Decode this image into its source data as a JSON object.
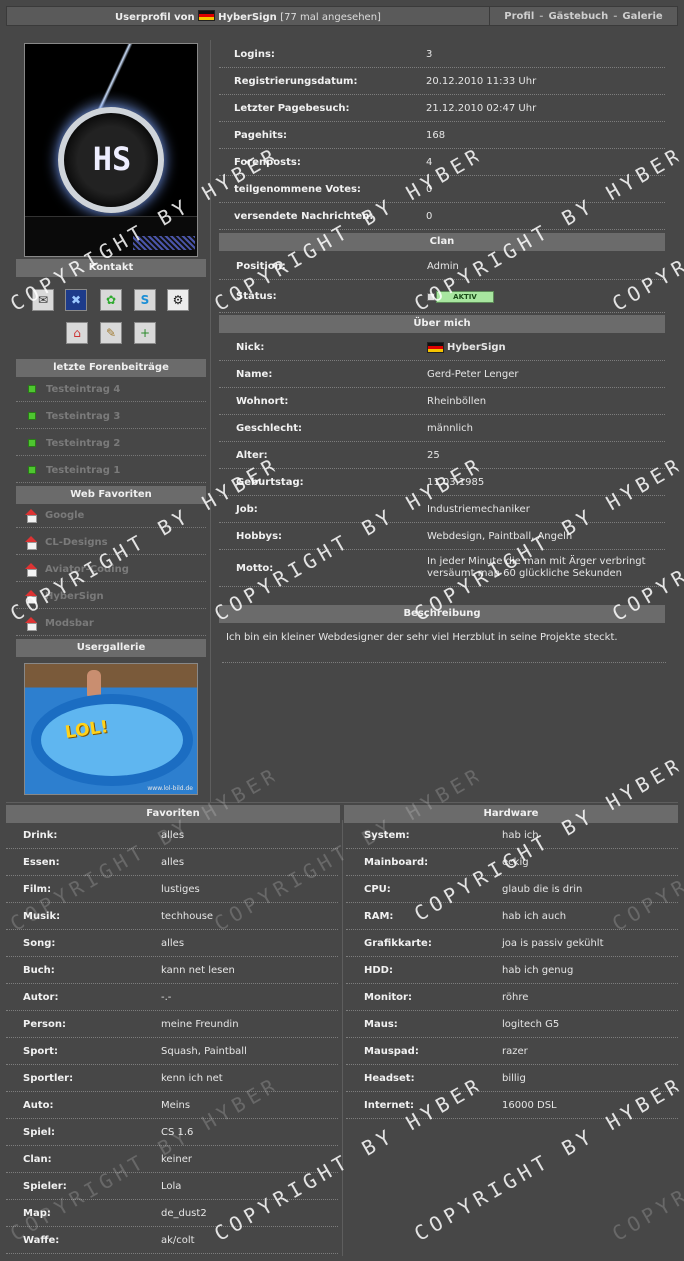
{
  "header": {
    "title_prefix": "Userprofil von",
    "username": "HyberSign",
    "views": "[77 mal angesehen]",
    "nav": [
      "Profil",
      "Gästebuch",
      "Galerie"
    ]
  },
  "stats": [
    {
      "label": "Logins:",
      "value": "3"
    },
    {
      "label": "Registrierungsdatum:",
      "value": "20.12.2010 11:33 Uhr"
    },
    {
      "label": "Letzter Pagebesuch:",
      "value": "21.12.2010 02:47 Uhr"
    },
    {
      "label": "Pagehits:",
      "value": "168"
    },
    {
      "label": "Forenposts:",
      "value": "4"
    },
    {
      "label": "teilgenommene Votes:",
      "value": "0"
    },
    {
      "label": "versendete Nachrichten:",
      "value": "0"
    }
  ],
  "clan": {
    "heading": "Clan",
    "position_label": "Position:",
    "position_value": "Admin",
    "status_label": "Status:",
    "status_badge": "AKTIV"
  },
  "about": {
    "heading": "Über mich",
    "rows": [
      {
        "label": "Nick:",
        "value": "HyberSign"
      },
      {
        "label": "Name:",
        "value": "Gerd-Peter Lenger"
      },
      {
        "label": "Wohnort:",
        "value": "Rheinböllen"
      },
      {
        "label": "Geschlecht:",
        "value": "männlich"
      },
      {
        "label": "Alter:",
        "value": "25"
      },
      {
        "label": "Geburtstag:",
        "value": "11.03.1985"
      },
      {
        "label": "Job:",
        "value": "Industriemechaniker"
      },
      {
        "label": "Hobbys:",
        "value": "Webdesign, Paintball, Angeln"
      },
      {
        "label": "Motto:",
        "value": "In jeder Minute die man mit Ärger verbringt versäumt man 60 glückliche Sekunden"
      }
    ]
  },
  "description": {
    "heading": "Beschreibung",
    "text": "Ich bin ein kleiner Webdesigner der sehr viel Herzblut in seine Projekte steckt."
  },
  "sidebar": {
    "contact_heading": "Kontakt",
    "contact_icons": [
      "mail-icon",
      "xfire-icon",
      "icq-icon",
      "skype-icon",
      "steam-icon",
      "homepage-icon",
      "guestbook-icon",
      "add-buddy-icon"
    ],
    "posts_heading": "letzte Forenbeiträge",
    "posts": [
      "Testeintrag 4",
      "Testeintrag 3",
      "Testeintrag 2",
      "Testeintrag 1"
    ],
    "favs_heading": "Web Favoriten",
    "favs": [
      "Google",
      "CL-Designs",
      "Aviator-Coding",
      "HyberSign",
      "Modsbar"
    ],
    "gallery_heading": "Usergallerie",
    "gallery_caption": "LOL!",
    "gallery_watermark": "www.lol-bild.de"
  },
  "favoriten": {
    "heading": "Favoriten",
    "rows": [
      {
        "label": "Drink:",
        "value": "alles"
      },
      {
        "label": "Essen:",
        "value": "alles"
      },
      {
        "label": "Film:",
        "value": "lustiges"
      },
      {
        "label": "Musik:",
        "value": "techhouse"
      },
      {
        "label": "Song:",
        "value": "alles"
      },
      {
        "label": "Buch:",
        "value": "kann net lesen"
      },
      {
        "label": "Autor:",
        "value": "-.-"
      },
      {
        "label": "Person:",
        "value": "meine Freundin"
      },
      {
        "label": "Sport:",
        "value": "Squash, Paintball"
      },
      {
        "label": "Sportler:",
        "value": "kenn ich net"
      },
      {
        "label": "Auto:",
        "value": "Meins"
      },
      {
        "label": "Spiel:",
        "value": "CS 1.6"
      },
      {
        "label": "Clan:",
        "value": "keiner"
      },
      {
        "label": "Spieler:",
        "value": "Lola"
      },
      {
        "label": "Map:",
        "value": "de_dust2"
      },
      {
        "label": "Waffe:",
        "value": "ak/colt"
      }
    ]
  },
  "hardware": {
    "heading": "Hardware",
    "rows": [
      {
        "label": "System:",
        "value": "hab ich"
      },
      {
        "label": "Mainboard:",
        "value": "eckig"
      },
      {
        "label": "CPU:",
        "value": "glaub die is drin"
      },
      {
        "label": "RAM:",
        "value": "hab ich auch"
      },
      {
        "label": "Grafikkarte:",
        "value": "joa is passiv gekühlt"
      },
      {
        "label": "HDD:",
        "value": "hab ich genug"
      },
      {
        "label": "Monitor:",
        "value": "röhre"
      },
      {
        "label": "Maus:",
        "value": "logitech G5"
      },
      {
        "label": "Mauspad:",
        "value": "razer"
      },
      {
        "label": "Headset:",
        "value": "billig"
      },
      {
        "label": "Internet:",
        "value": "16000 DSL"
      }
    ]
  },
  "watermark": "COPYRIGHT BY HYBERSIGN",
  "colors": {
    "background": "#474747",
    "section_header": "#6b6b6b",
    "bullet": "#4ec630",
    "flag_red": "#dd0000"
  }
}
